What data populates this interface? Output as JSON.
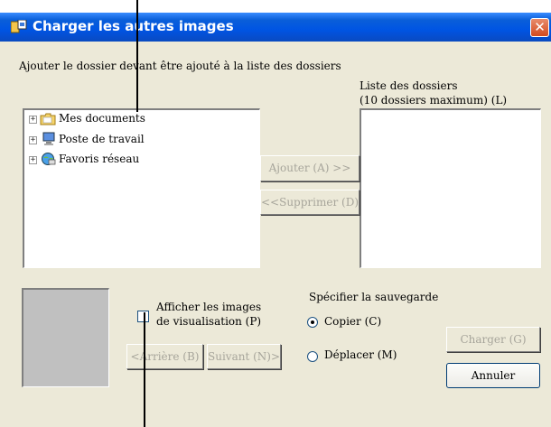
{
  "window": {
    "title": "Charger les autres images",
    "close_glyph": "✕"
  },
  "instruction": "Ajouter le dossier devant être ajouté à la liste des dossiers",
  "tree": {
    "items": [
      {
        "label": "Mes documents",
        "icon": "folder-icon"
      },
      {
        "label": "Poste de travail",
        "icon": "computer-icon"
      },
      {
        "label": "Favoris réseau",
        "icon": "network-icon"
      }
    ]
  },
  "folder_list": {
    "label_line1": "Liste des dossiers",
    "label_line2": "(10 dossiers maximum) (L)"
  },
  "buttons": {
    "add": "Ajouter (A) >>",
    "remove": "<<Supprimer (D)",
    "back": "<Arrière (B)",
    "next": "Suivant (N)>",
    "load": "Charger (G)",
    "cancel": "Annuler"
  },
  "preview": {
    "checkbox_line1": "Afficher les images",
    "checkbox_line2": "de visualisation (P)",
    "checked": false
  },
  "save": {
    "title": "Spécifier la sauvegarde",
    "options": [
      {
        "label": "Copier (C)",
        "selected": true
      },
      {
        "label": "Déplacer (M)",
        "selected": false
      }
    ]
  },
  "colors": {
    "titlebar": "#0054e3",
    "dialog_bg": "#ece9d8",
    "close_button": "#d44a1e",
    "disabled_text": "#a7a59b"
  }
}
